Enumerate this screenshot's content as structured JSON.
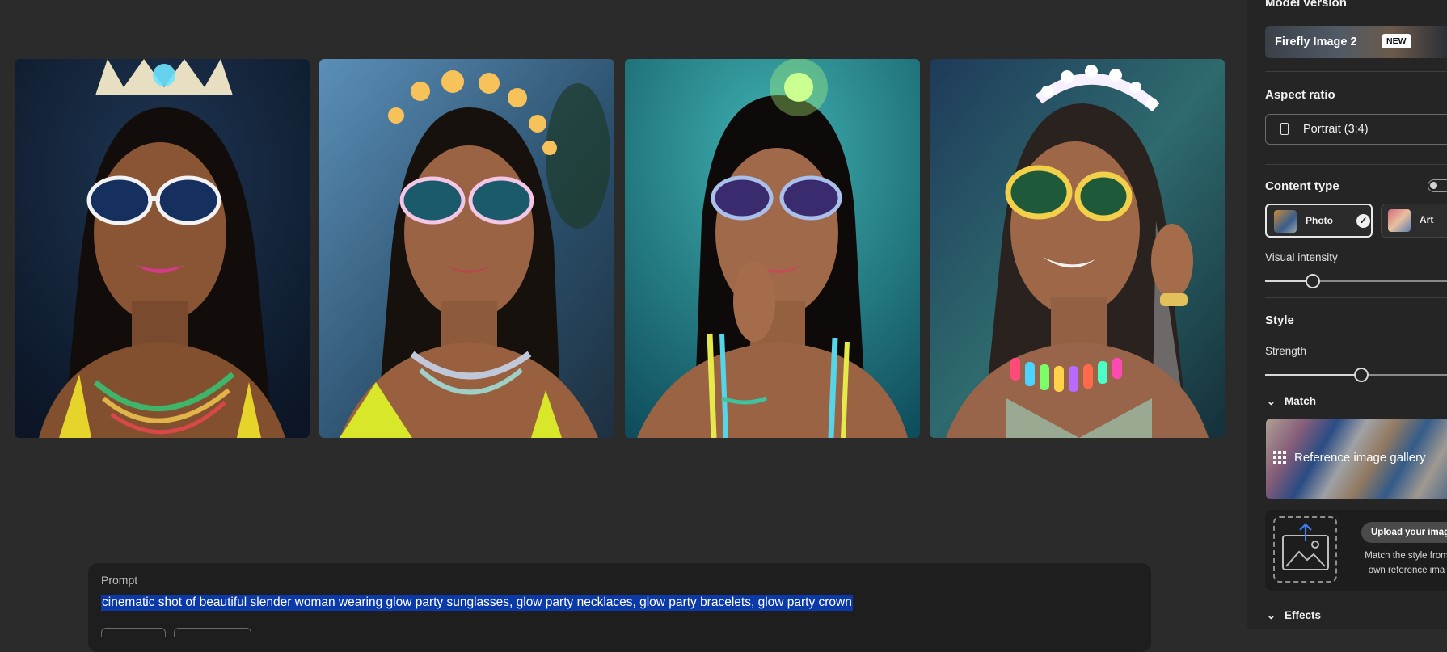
{
  "gallery": {
    "images": [
      {
        "label": "Generated image 1"
      },
      {
        "label": "Generated image 2"
      },
      {
        "label": "Generated image 3"
      },
      {
        "label": "Generated image 4"
      }
    ]
  },
  "prompt": {
    "label": "Prompt",
    "text": "cinematic shot of beautiful slender woman wearing glow party sunglasses, glow party necklaces, glow party bracelets, glow party crown"
  },
  "panel": {
    "model_version": {
      "heading": "Model version",
      "value": "Firefly Image 2",
      "badge": "NEW"
    },
    "aspect_ratio": {
      "heading": "Aspect ratio",
      "value": "Portrait (3:4)",
      "icon": "portrait-icon"
    },
    "content_type": {
      "heading": "Content type",
      "toggle_on": false,
      "options": [
        {
          "label": "Photo",
          "selected": true
        },
        {
          "label": "Art",
          "selected": false
        }
      ]
    },
    "visual_intensity": {
      "label": "Visual intensity",
      "value_fraction": 0.26
    },
    "style": {
      "heading": "Style",
      "strength_label": "Strength",
      "strength_fraction": 0.53
    },
    "match": {
      "heading": "Match",
      "expanded": true,
      "gallery_label": "Reference image gallery",
      "upload_button": "Upload your image",
      "upload_description_line1": "Match the style from",
      "upload_description_line2": "own reference ima"
    },
    "effects": {
      "heading": "Effects",
      "expanded": true
    }
  },
  "colors": {
    "background": "#2b2b2b",
    "panel": "#252525",
    "prompt_box": "#1e1e1e",
    "selection": "#0b3aa8"
  }
}
